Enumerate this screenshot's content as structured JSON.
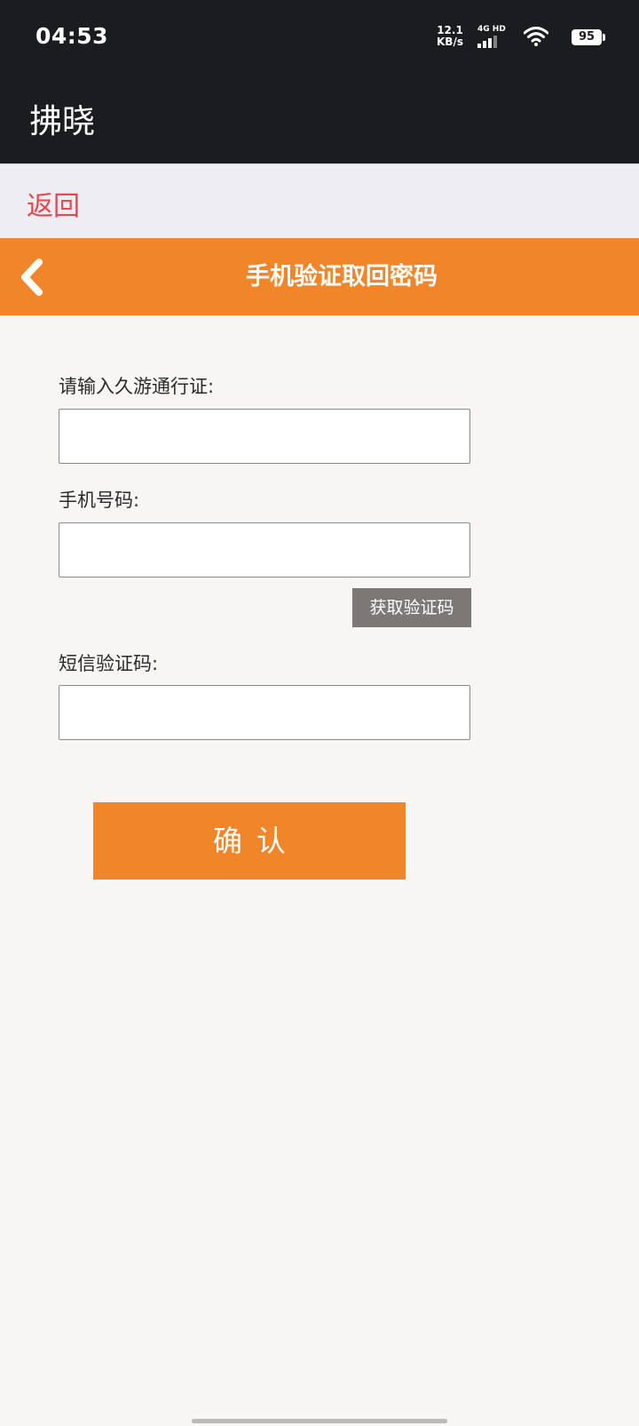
{
  "status_bar": {
    "time": "04:53",
    "net_speed_value": "12.1",
    "net_speed_unit": "KB/s",
    "network_type": "4G HD",
    "battery": "95"
  },
  "app_header": {
    "title": "拂晓"
  },
  "back_bar": {
    "label": "返回"
  },
  "page": {
    "title": "手机验证取回密码"
  },
  "form": {
    "passport_label": "请输入久游通行证:",
    "passport_value": "",
    "phone_label": "手机号码:",
    "phone_value": "",
    "get_code_label": "获取验证码",
    "sms_label": "短信验证码:",
    "sms_value": "",
    "confirm_label": "确认"
  },
  "colors": {
    "accent": "#f08629",
    "back_link": "#e5484d",
    "header_bg": "#1b1c20",
    "code_button_bg": "#7b7875"
  }
}
